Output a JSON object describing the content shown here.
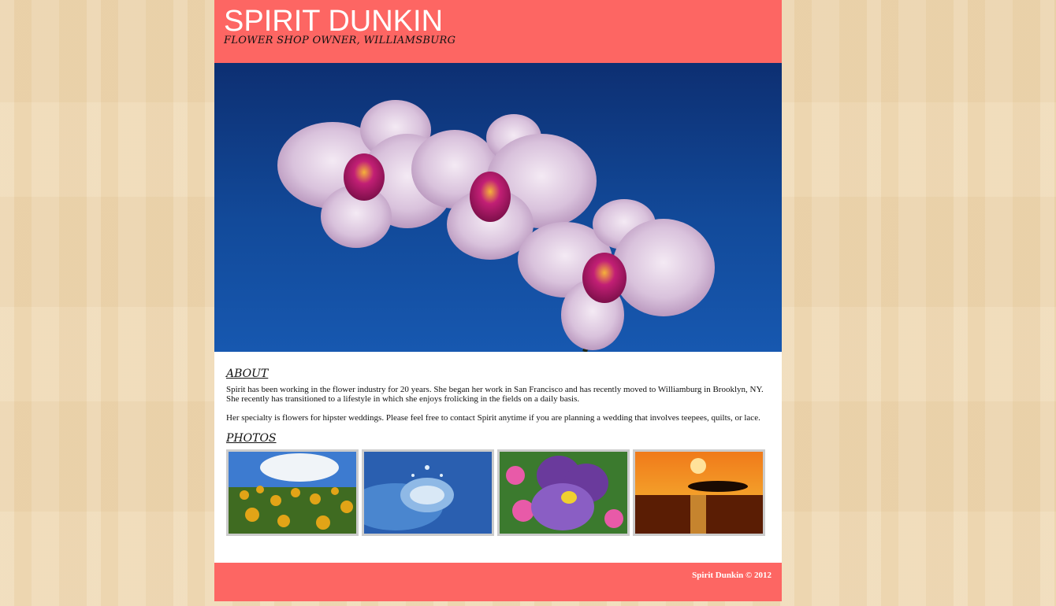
{
  "header": {
    "title": "SPIRIT DUNKIN",
    "subtitle": "FLOWER SHOP OWNER, WILLIAMSBURG"
  },
  "about": {
    "heading": "ABOUT",
    "paragraphs": [
      "Spirit has been working in the flower industry for 20 years. She began her work in San Francisco and has recently moved to Williamburg in Brooklyn, NY. She recently has transitioned to a lifestyle in which she enjoys frolicking in the fields on a daily basis.",
      "Her specialty is flowers for hipster weddings. Please feel free to contact Spirit anytime if you are planning a wedding that involves teepees, quilts, or lace."
    ]
  },
  "photos": {
    "heading": "PHOTOS"
  },
  "footer": {
    "text": "Spirit Dunkin © 2012"
  },
  "colors": {
    "header_bg": "#fd6663",
    "footer_bg": "#fd6663",
    "page_bg": "#efd9b4",
    "content_bg": "#ffffff",
    "photo_border": "#cccccc"
  }
}
